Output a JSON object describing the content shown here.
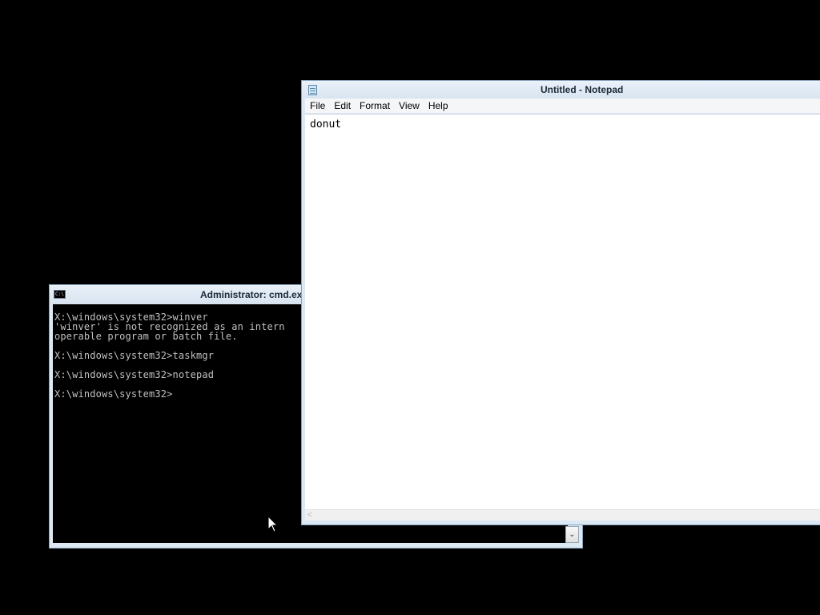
{
  "cmd": {
    "title": "Administrator: cmd.exe",
    "icon_label": "C:\\",
    "lines": [
      "X:\\windows\\system32>winver",
      "'winver' is not recognized as an intern",
      "operable program or batch file.",
      "",
      "X:\\windows\\system32>taskmgr",
      "",
      "X:\\windows\\system32>notepad",
      "",
      "X:\\windows\\system32>"
    ],
    "scroll_down_glyph": "⌄"
  },
  "notepad": {
    "title": "Untitled - Notepad",
    "menu": [
      "File",
      "Edit",
      "Format",
      "View",
      "Help"
    ],
    "content": "donut",
    "scroll_left_glyph": "<"
  },
  "icons": {
    "cmd_icon": "console-icon",
    "notepad_icon": "notepad-icon",
    "cursor": "mouse-pointer-icon"
  }
}
